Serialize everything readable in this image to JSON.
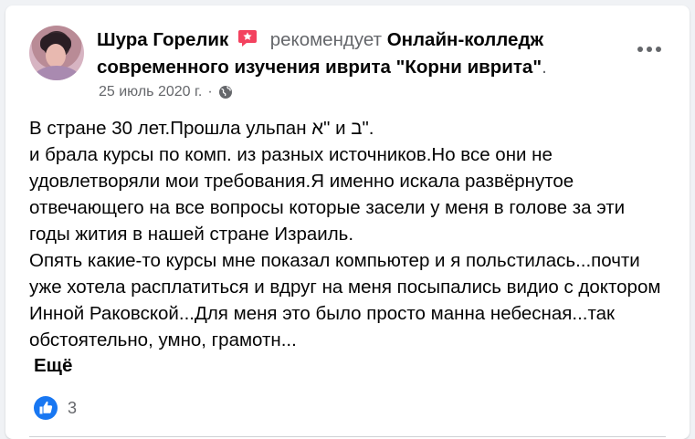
{
  "post": {
    "author_name": "Шура Горелик",
    "action_text": "рекомендует",
    "page_name": "Онлайн-колледж современного изучения иврита \"Корни иврита\"",
    "page_name_suffix": ".",
    "date": "25 июль 2020 г.",
    "separator": "·",
    "body_text": "В стране 30 лет.Прошла ульпан א\" и ב\".\nи брала курсы по комп. из разных источников.Но все они не удовлетворяли мои требования.Я именно искала развёрнутое отвечающего на все вопросы которые засели у меня в голове за эти годы жития в нашей стране Израиль.\nОпять какие-то курсы мне показал компьютер и я польстилась...почти уже хотела расплатиться и вдруг на меня посыпались видио с доктором Инной Раковской...Для меня это было просто манна небесная...так обстоятельно, умно, грамотн...",
    "see_more_label": "Ещё",
    "reaction_count": "3"
  },
  "icons": {
    "recommend": "recommend-star-icon",
    "audience": "globe-icon",
    "more": "more-options-icon",
    "reaction": "like-icon"
  },
  "colors": {
    "recommend_red": "#f3425f",
    "like_blue": "#1877f2",
    "secondary_text": "#65676b",
    "primary_text": "#050505"
  }
}
